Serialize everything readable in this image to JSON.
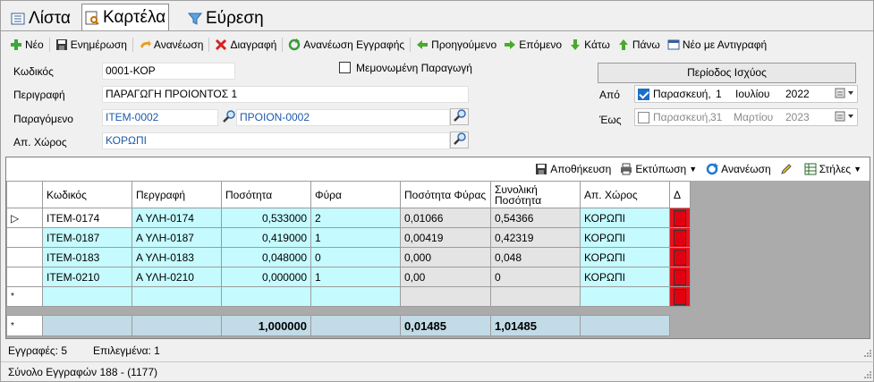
{
  "tabs": [
    {
      "label": "Λίστα",
      "icon": "list-icon",
      "active": false
    },
    {
      "label": "Καρτέλα",
      "icon": "card-icon",
      "active": true
    },
    {
      "label": "Εύρεση",
      "icon": "filter-icon",
      "active": false
    }
  ],
  "toolbar": {
    "new": "Νέο",
    "update": "Ενημέρωση",
    "refresh": "Ανανέωση",
    "delete": "Διαγραφή",
    "refresh_record": "Ανανέωση Εγγραφής",
    "previous": "Προηγούμενο",
    "next": "Επόμενο",
    "down": "Κάτω",
    "up": "Πάνω",
    "new_copy": "Νέο με Αντιγραφή"
  },
  "form": {
    "code_label": "Κωδικός",
    "code_value": "0001-ΚΟΡ",
    "isolated_label": "Μεμονωμένη Παραγωγή",
    "isolated_checked": false,
    "description_label": "Περιγραφή",
    "description_value": "ΠΑΡΑΓΩΓΗ ΠΡΟΙΟΝΤΟΣ 1",
    "product_label": "Παραγόμενο",
    "product_code": "ITEM-0002",
    "product_name": "ΠΡΟΙΟΝ-0002",
    "warehouse_label": "Απ. Χώρος",
    "warehouse_value": "ΚΟΡΩΠΙ"
  },
  "validity": {
    "button_label": "Περίοδος Ισχύος",
    "from_label": "Από",
    "from_checked": true,
    "from_day": "Παρασκευή,",
    "from_date": "1",
    "from_month": "Ιουλίου",
    "from_year": "2022",
    "to_label": "Έως",
    "to_checked": false,
    "to_day": "Παρασκευή,",
    "to_date": "31",
    "to_month": "Μαρτίου",
    "to_year": "2023"
  },
  "gridbar": {
    "save": "Αποθήκευση",
    "print": "Εκτύπωση",
    "refresh": "Ανανέωση",
    "columns": "Στήλες"
  },
  "grid": {
    "headers": [
      "Κωδικός",
      "Περγραφή",
      "Ποσότητα",
      "Φύρα",
      "Ποσότητα Φύρας",
      "Συνολική Ποσότητα",
      "Απ. Χώρος",
      "Δ"
    ],
    "rows": [
      [
        "ITEM-0174",
        "Α ΥΛΗ-0174",
        "0,533000",
        "2",
        "0,01066",
        "0,54366",
        "ΚΟΡΩΠΙ"
      ],
      [
        "ITEM-0187",
        "Α ΥΛΗ-0187",
        "0,419000",
        "1",
        "0,00419",
        "0,42319",
        "ΚΟΡΩΠΙ"
      ],
      [
        "ITEM-0183",
        "Α ΥΛΗ-0183",
        "0,048000",
        "0",
        "0,000",
        "0,048",
        "ΚΟΡΩΠΙ"
      ],
      [
        "ITEM-0210",
        "Α ΥΛΗ-0210",
        "0,000000",
        "1",
        "0,00",
        "0",
        "ΚΟΡΩΠΙ"
      ]
    ],
    "new_row_marker": "*",
    "current_row_marker": "▷",
    "totals": {
      "marker": "*",
      "quantity": "1,000000",
      "waste_qty": "0,01485",
      "total_qty": "1,01485"
    }
  },
  "status": {
    "records_label": "Εγγραφές: 5",
    "selected_label": "Επιλεγμένα: 1",
    "total_label": "Σύνολο Εγγραφών 188  - (1177)"
  },
  "colors": {
    "accent": "#1c6fc8",
    "cyan": "#c5fbff",
    "red": "#e00010",
    "link": "#1e5aa8",
    "total_bg": "#c2dbe6"
  }
}
